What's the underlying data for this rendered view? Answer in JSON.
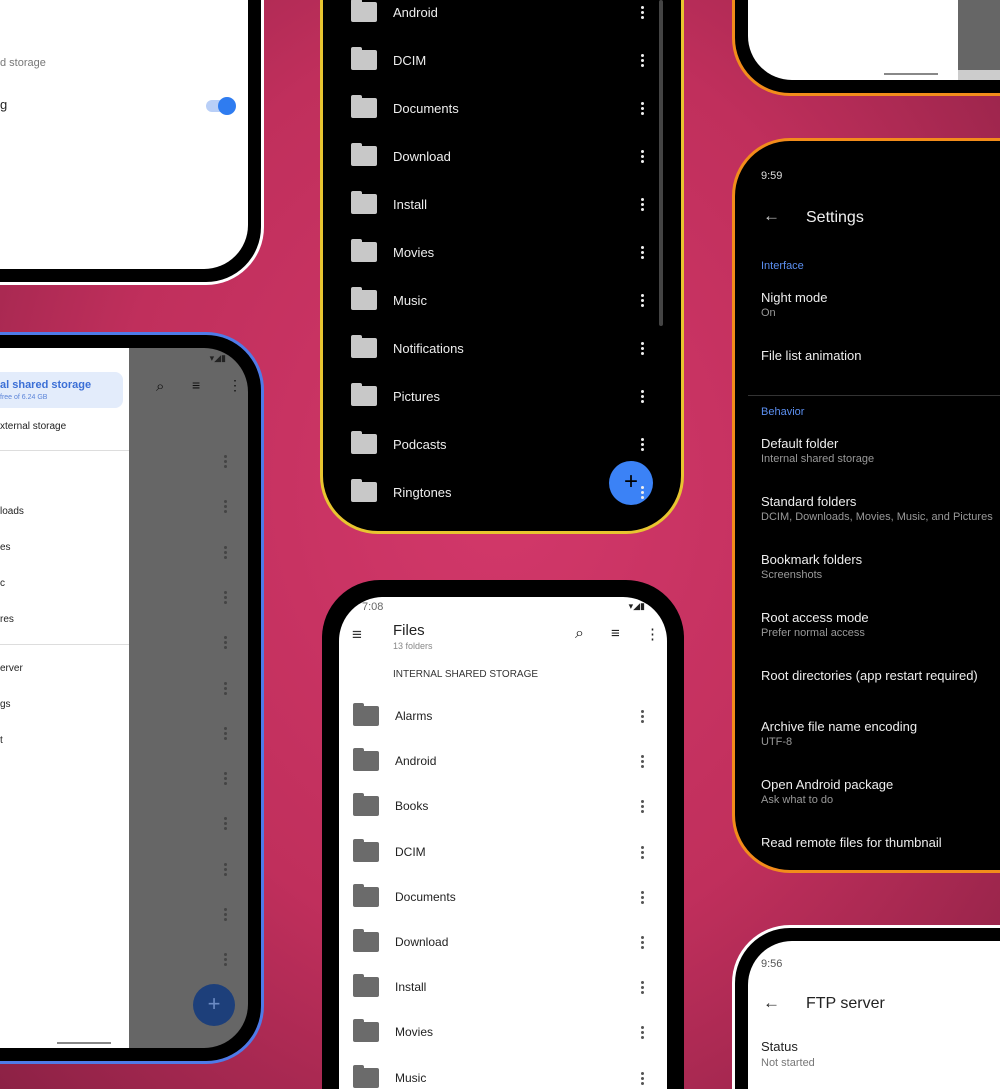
{
  "colors": {
    "background": "#c8325f",
    "accent": "#3b82f6",
    "frame_yellow": "#e8c530",
    "frame_blue": "#4f7be8",
    "frame_orange": "#f28c1b"
  },
  "phone_top_left": {
    "subtitle": "d storage",
    "label": "g",
    "toggle_on": true
  },
  "phone_drawer": {
    "items": [
      {
        "label": "al shared storage",
        "sub": "free of 6.24 GB",
        "selected": true
      },
      {
        "label": "xternal storage"
      }
    ],
    "folders": [
      "loads",
      "es",
      "c",
      "res"
    ],
    "others": [
      "erver",
      "gs",
      "t"
    ],
    "icons": [
      "search-icon",
      "sort-icon",
      "more-icon"
    ]
  },
  "phone_dark_files": {
    "folders": [
      "Android",
      "DCIM",
      "Documents",
      "Download",
      "Install",
      "Movies",
      "Music",
      "Notifications",
      "Pictures",
      "Podcasts",
      "Ringtones"
    ],
    "fab": "+"
  },
  "phone_files": {
    "time": "7:08",
    "title": "Files",
    "subtitle": "13 folders",
    "section": "INTERNAL SHARED STORAGE",
    "folders": [
      "Alarms",
      "Android",
      "Books",
      "DCIM",
      "Documents",
      "Download",
      "Install",
      "Movies",
      "Music"
    ]
  },
  "phone_settings": {
    "time": "9:59",
    "title": "Settings",
    "sections": [
      {
        "header": "Interface",
        "items": [
          {
            "title": "Night mode",
            "sub": "On"
          },
          {
            "title": "File list animation"
          }
        ]
      },
      {
        "header": "Behavior",
        "items": [
          {
            "title": "Default folder",
            "sub": "Internal shared storage"
          },
          {
            "title": "Standard folders",
            "sub": "DCIM, Downloads, Movies, Music, and Pictures"
          },
          {
            "title": "Bookmark folders",
            "sub": "Screenshots"
          },
          {
            "title": "Root access mode",
            "sub": "Prefer normal access"
          },
          {
            "title": "Root directories (app restart required)"
          },
          {
            "title": "Archive file name encoding",
            "sub": "UTF-8"
          },
          {
            "title": "Open Android package",
            "sub": "Ask what to do"
          },
          {
            "title": "Read remote files for thumbnail"
          }
        ]
      }
    ]
  },
  "phone_ftp": {
    "time": "9:56",
    "title": "FTP server",
    "status_label": "Status",
    "status_value": "Not started"
  }
}
